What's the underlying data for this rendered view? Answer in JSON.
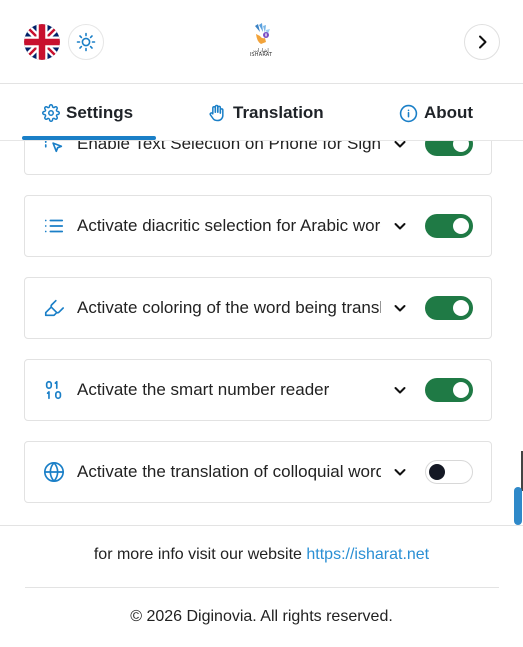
{
  "header": {
    "language_flag": "uk-flag-icon",
    "theme_icon": "sun-icon",
    "logo_arabic": "إشارات",
    "logo_english": "ISHARAT",
    "next_icon": "chevron-right-icon"
  },
  "tabs": [
    {
      "label": "Settings",
      "icon": "gear-icon",
      "active": true
    },
    {
      "label": "Translation",
      "icon": "hand-icon",
      "active": false
    },
    {
      "label": "About",
      "icon": "info-icon",
      "active": false
    }
  ],
  "settings": [
    {
      "label": "Enable Text Selection on Phone for Sign",
      "icon": "pointer-selection-icon",
      "enabled": true
    },
    {
      "label": "Activate diacritic selection for Arabic words",
      "icon": "list-icon",
      "enabled": true
    },
    {
      "label": "Activate coloring of the word being translated",
      "icon": "highlighter-icon",
      "enabled": true
    },
    {
      "label": "Activate the smart number reader",
      "icon": "binary-icon",
      "enabled": true
    },
    {
      "label": "Activate the translation of colloquial words",
      "icon": "globe-icon",
      "enabled": false
    }
  ],
  "footer": {
    "info_text": "for more info visit our website",
    "link_text": "https://isharat.net",
    "copyright": "© 2026 Diginovia. All rights reserved."
  },
  "colors": {
    "accent": "#1a7fc7",
    "toggle_on": "#1f7a45",
    "link": "#2a8fd4"
  }
}
